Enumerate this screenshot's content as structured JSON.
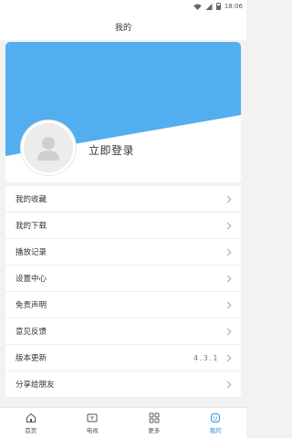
{
  "status_bar": {
    "time": "18:06"
  },
  "header": {
    "title": "我的"
  },
  "profile": {
    "login_label": "立即登录",
    "banner_color": "#53aef0"
  },
  "menu": {
    "items": [
      {
        "label": "我的收藏"
      },
      {
        "label": "我的下载"
      },
      {
        "label": "播放记录"
      },
      {
        "label": "设置中心"
      },
      {
        "label": "免责声明"
      },
      {
        "label": "意见反馈"
      },
      {
        "label": "版本更新",
        "value": "4.3.1"
      },
      {
        "label": "分享给朋友"
      }
    ]
  },
  "tabbar": {
    "tabs": [
      {
        "label": "首页",
        "icon": "home-icon"
      },
      {
        "label": "电视",
        "icon": "tv-icon"
      },
      {
        "label": "更多",
        "icon": "grid-icon"
      },
      {
        "label": "我的",
        "icon": "profile-face-icon",
        "active": true
      }
    ],
    "active_color": "#2f8fe0"
  }
}
